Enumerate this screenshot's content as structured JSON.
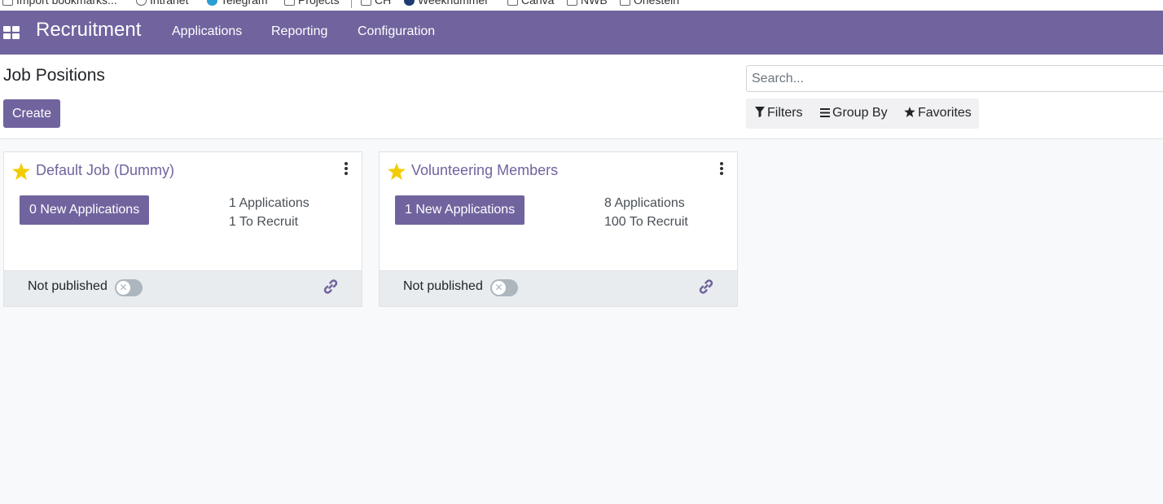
{
  "bookmarks": [
    {
      "label": "Import bookmarks...",
      "icon": "folder-icon"
    },
    {
      "label": "Intranet",
      "icon": "globe-icon"
    },
    {
      "label": "Telegram",
      "icon": "telegram-icon"
    },
    {
      "label": "Projects",
      "icon": "folder-icon"
    },
    {
      "label": "CH",
      "icon": "folder-icon"
    },
    {
      "label": "Weekhummer",
      "icon": "globe-icon"
    },
    {
      "label": "Canva",
      "icon": "folder-icon"
    },
    {
      "label": "NWB",
      "icon": "folder-icon"
    },
    {
      "label": "Ohestein",
      "icon": "folder-icon"
    }
  ],
  "navbar": {
    "brand": "Recruitment",
    "menu": [
      "Applications",
      "Reporting",
      "Configuration"
    ],
    "color": "#71639e"
  },
  "control_panel": {
    "title": "Job Positions",
    "create_label": "Create",
    "search_placeholder": "Search...",
    "filters_label": "Filters",
    "group_by_label": "Group By",
    "favorites_label": "Favorites"
  },
  "jobs": [
    {
      "name": "Default Job (Dummy)",
      "new_applications": "0 New Applications",
      "applications": "1 Applications",
      "to_recruit": "1 To Recruit",
      "published_label": "Not published",
      "favorite": true
    },
    {
      "name": "Volunteering Members",
      "new_applications": "1 New Applications",
      "applications": "8 Applications",
      "to_recruit": "100 To Recruit",
      "published_label": "Not published",
      "favorite": true
    }
  ]
}
